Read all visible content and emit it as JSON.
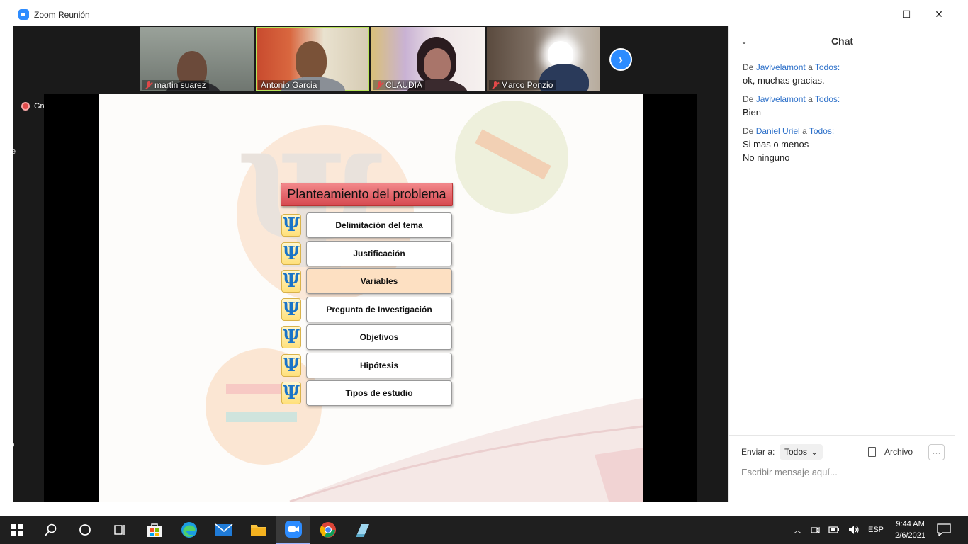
{
  "window": {
    "title": "Zoom Reunión",
    "controls": {
      "minimize": "—",
      "maximize": "☐",
      "close": "✕"
    }
  },
  "meeting": {
    "left_edge_labels": [
      "De",
      "ca",
      "Yo"
    ],
    "recording_label": "Grabando",
    "participants": [
      {
        "name": "martin suarez",
        "muted": true
      },
      {
        "name": "Antonio Garcia",
        "muted": false
      },
      {
        "name": "CLAUDIA",
        "muted": true
      },
      {
        "name": "Marco Ponzio",
        "muted": true
      }
    ],
    "next_page_icon": "chevron-right-icon"
  },
  "slide": {
    "title": "Planteamiento del problema",
    "items": [
      {
        "label": "Delimitación del tema",
        "highlight": false
      },
      {
        "label": "Justificación",
        "highlight": false
      },
      {
        "label": "Variables",
        "highlight": true
      },
      {
        "label": "Pregunta de Investigación",
        "highlight": false
      },
      {
        "label": "Objetivos",
        "highlight": false
      },
      {
        "label": "Hipótesis",
        "highlight": false
      },
      {
        "label": "Tipos de estudio",
        "highlight": false
      }
    ],
    "psi_glyph": "Ψ"
  },
  "chat": {
    "title": "Chat",
    "messages": [
      {
        "prefix": "De",
        "sender": "Javivelamont",
        "mid": "a",
        "recipient": "Todos:",
        "lines": [
          "ok, muchas gracias."
        ]
      },
      {
        "prefix": "De",
        "sender": "Javivelamont",
        "mid": "a",
        "recipient": "Todos:",
        "lines": [
          "Bien"
        ]
      },
      {
        "prefix": "De",
        "sender": "Daniel Uriel",
        "mid": "a",
        "recipient": "Todos:",
        "lines": [
          "Si mas o menos",
          "No ninguno"
        ]
      }
    ],
    "send_to_label": "Enviar a:",
    "send_to_value": "Todos",
    "file_label": "Archivo",
    "more_label": "···",
    "input_placeholder": "Escribir mensaje aquí..."
  },
  "taskbar": {
    "apps": [
      "windows-start-icon",
      "search-icon",
      "cortana-icon",
      "task-view-icon",
      "store-icon",
      "edge-icon",
      "mail-icon",
      "file-explorer-icon",
      "zoom-icon",
      "chrome-icon",
      "app-icon"
    ],
    "active_app": "zoom-icon",
    "language": "ESP",
    "time": "9:44 AM",
    "date": "2/6/2021"
  },
  "colors": {
    "zoom_blue": "#2d8cff",
    "title_red": "#d64950",
    "highlight_peach": "#fde0c2",
    "psi_blue": "#1a74c7"
  }
}
